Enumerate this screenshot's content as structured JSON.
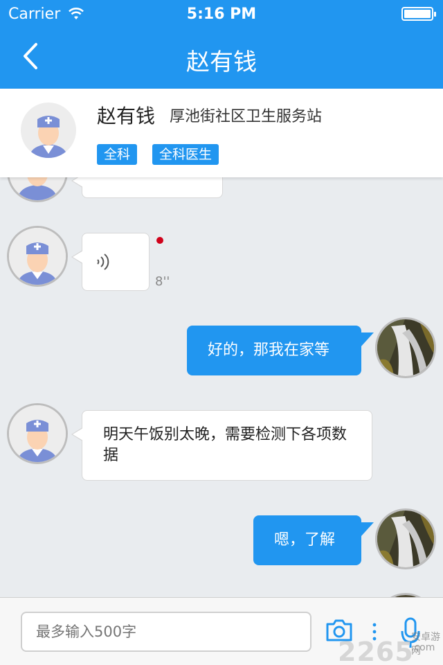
{
  "status_bar": {
    "carrier": "Carrier",
    "time": "5:16 PM"
  },
  "nav": {
    "title": "赵有钱"
  },
  "doctor": {
    "name": "赵有钱",
    "organization": "厚池街社区卫生服务站",
    "tags": [
      "全科",
      "全科医生"
    ]
  },
  "messages": [
    {
      "side": "left",
      "type": "text-cut",
      "text": ""
    },
    {
      "side": "left",
      "type": "voice",
      "duration": "8''",
      "unread": true
    },
    {
      "side": "right",
      "type": "text",
      "text": "好的，那我在家等"
    },
    {
      "side": "left",
      "type": "text",
      "text": "明天午饭别太晚，需要检测下各项数据"
    },
    {
      "side": "right",
      "type": "text",
      "text": "嗯，了解"
    }
  ],
  "input": {
    "placeholder": "最多输入500字"
  },
  "watermark": {
    "main": "2265",
    "line1": "安卓游网",
    "line2": ".com"
  },
  "colors": {
    "primary": "#2196f0",
    "unread_dot": "#d0021b",
    "chat_bg": "#e9ecef"
  },
  "icons": [
    "back-icon",
    "wifi-icon",
    "battery-icon",
    "doctor-avatar-icon",
    "voice-wave-icon",
    "camera-icon",
    "more-icon",
    "microphone-icon"
  ]
}
